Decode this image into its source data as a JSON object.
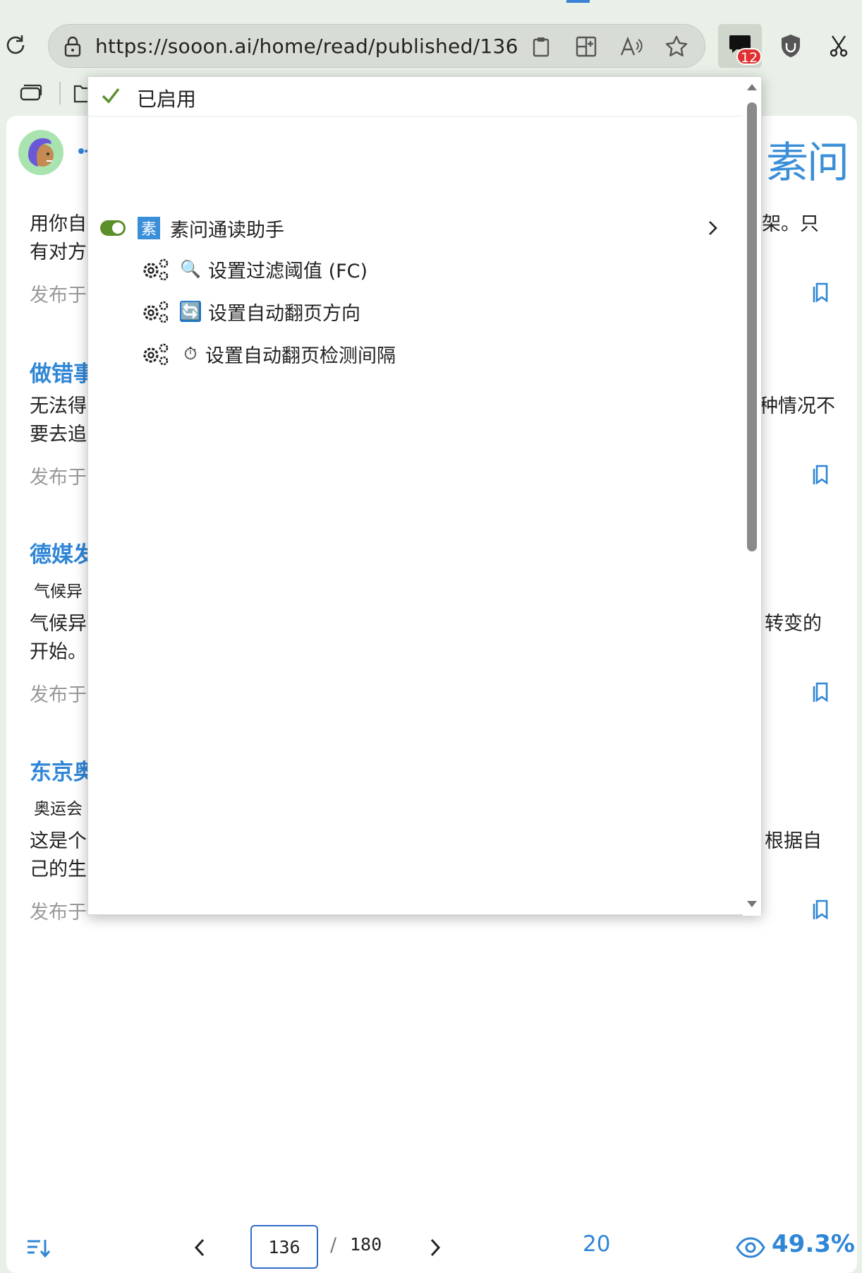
{
  "browser": {
    "url": "https://sooon.ai/home/read/published/136",
    "extension_badge": "12"
  },
  "site": {
    "brand": "素问"
  },
  "articles": [
    {
      "title": "",
      "text_left_1": "用你自",
      "text_left_2": "有对方",
      "text_right_1": "架。只",
      "meta": "发布于"
    },
    {
      "title": "做错事",
      "text_left_1": "无法得",
      "text_left_2": "要去追",
      "text_right_1": "种情况不",
      "meta": "发布于"
    },
    {
      "title": "德媒发",
      "tag": "气候异",
      "text_left_1": "气候异",
      "text_left_2": "开始。",
      "text_right_1": "转变的",
      "meta": "发布于"
    },
    {
      "title": "东京奥",
      "tag": "奥运会",
      "text_left_1": "这是个",
      "text_left_2": "己的生",
      "text_right_1": "根据自",
      "meta": "发布于"
    }
  ],
  "pager": {
    "current_page": "136",
    "slash": "/",
    "total_pages": "180",
    "count": "20",
    "percent": "49.3%"
  },
  "popup": {
    "enabled_label": "已启用",
    "extension_name": "素问通读助手",
    "extension_logo_char": "素",
    "menu_items": [
      {
        "label": "设置过滤阈值 (FC)",
        "icon": "🔍"
      },
      {
        "label": "设置自动翻页方向",
        "icon": "🔄"
      },
      {
        "label": "设置自动翻页检测间隔",
        "icon": "⏱"
      }
    ]
  },
  "colors": {
    "accent": "#2f86d6",
    "toggle_on": "#5a8f2a",
    "badge": "#e03030"
  }
}
